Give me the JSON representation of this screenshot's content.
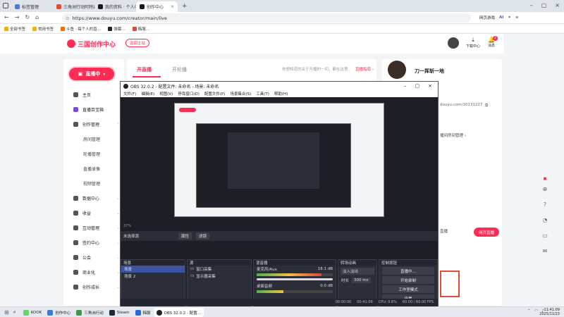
{
  "browser": {
    "tabs": [
      {
        "label": "标签管理",
        "color": "#4a7bd9"
      },
      {
        "label": "三角洲行动阿特森大…",
        "color": "#e04b3a"
      },
      {
        "label": "我的资料 · 个人中心 · 斗…",
        "color": "#1a1a1a"
      },
      {
        "label": "创作中心",
        "color": "#1a1a1a"
      }
    ],
    "new_tab": "+",
    "url": "https://www.douyu.com/creator/main/live",
    "bookmarks": [
      "全部书签",
      "常用书签",
      "斗鱼 · 每个人的直…",
      "弹幕…",
      "韩服…"
    ],
    "right_tools": [
      "网页游戏",
      "AI"
    ]
  },
  "site": {
    "logo_text": "三国创作中心",
    "back_button": "返回主站",
    "download_label": "下载中心",
    "notify_label": "消息",
    "notify_count": "2"
  },
  "sidebar": {
    "live_button": "直播中",
    "items": [
      {
        "label": "主页",
        "sub": false
      },
      {
        "label": "直播百宝箱",
        "sub": false
      },
      {
        "label": "创作管理",
        "sub": false,
        "chev": "⌃"
      },
      {
        "label": "房间管理",
        "sub": true
      },
      {
        "label": "轮播管理",
        "sub": true
      },
      {
        "label": "直播录像",
        "sub": true
      },
      {
        "label": "视频管理",
        "sub": true
      },
      {
        "label": "数据中心",
        "sub": false,
        "chev": "⌄"
      },
      {
        "label": "收益",
        "sub": false,
        "chev": "⌄"
      },
      {
        "label": "互动管理",
        "sub": false,
        "chev": "⌄"
      },
      {
        "label": "签约中心",
        "sub": false,
        "chev": "⌄"
      },
      {
        "label": "公会",
        "sub": false,
        "chev": "⌄"
      },
      {
        "label": "商业化",
        "sub": false,
        "chev": "⌄"
      },
      {
        "label": "创作成长",
        "sub": false,
        "chev": "⌄"
      }
    ]
  },
  "main": {
    "tabs": [
      "开直播",
      "开轮播"
    ],
    "notice": "你想知道的关于开播的一切，都在这里",
    "notice_link": "直播指南 ›",
    "right_text_1": "直播",
    "right_text_2": "网页直播"
  },
  "profile": {
    "name": "刀一挥斩一地",
    "room_url": "douyu.com/10131227",
    "link_text": "播间房间管理 ›"
  },
  "obs": {
    "title": "OBS 32.0.2 - 配置文件: 未命名 - 场景: 未命名",
    "menus": [
      "文件(F)",
      "编辑(E)",
      "视图(V)",
      "停靠窗口(D)",
      "配置文件(P)",
      "场景集合(S)",
      "工具(T)",
      "帮助(H)"
    ],
    "zoom": "37%",
    "no_source": "未选择源",
    "props_btn": "属性",
    "filter_btn": "滤镜",
    "scenes_header": "场景",
    "scenes": [
      "场景",
      "场景 2"
    ],
    "sources_header": "源",
    "sources": [
      "窗口采集",
      "显示器采集"
    ],
    "mixer_header": "混音器",
    "mixer": [
      {
        "label": "麦克风/Aux",
        "db": "18.1 dB",
        "level": 0.85
      },
      {
        "label": "桌面音频",
        "db": "0.0 dB",
        "level": 0.35
      }
    ],
    "transitions_header": "转场动画",
    "transition_type": "淡入淡出",
    "duration_label": "时长",
    "duration_value": "300 ms",
    "controls_header": "控制按钮",
    "controls": [
      "直播中…",
      "开始录制",
      "工作室模式",
      "设置"
    ],
    "status": {
      "time1": "00:00:00",
      "time2": "00:41:09",
      "cpu": "CPU: 0.6%",
      "fps": "60.00 / 60.00 FPS"
    }
  },
  "taskbar": {
    "apps": [
      {
        "label": "KOOK",
        "color": "#6bd26b"
      },
      {
        "label": "创作中心",
        "color": "#3b7bd6"
      },
      {
        "label": "三角洲行动",
        "color": "#3a9a4a"
      },
      {
        "label": "Steam",
        "color": "#1b2838"
      },
      {
        "label": "韩服",
        "color": "#2a6ad6"
      },
      {
        "label": "OBS 32.0.2 - 配置…",
        "color": "#222"
      }
    ],
    "clock_time": "11:41:09",
    "clock_date": "2025/11/23"
  },
  "colors": {
    "accent": "#fe2c55",
    "obs_bg": "#2b2e38"
  }
}
